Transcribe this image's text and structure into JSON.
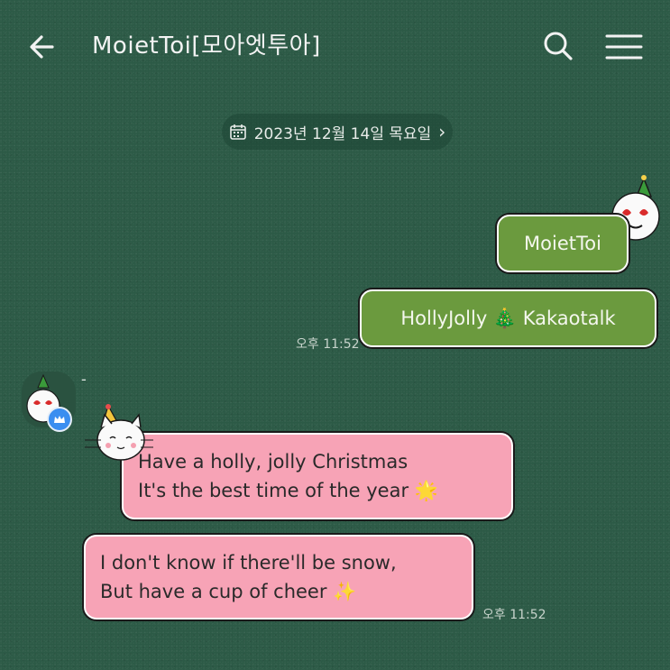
{
  "header": {
    "title": "MoietToi[모아엣투아]",
    "back_icon": "arrow-left-icon",
    "search_icon": "search-icon",
    "menu_icon": "hamburger-menu-icon"
  },
  "date_divider": {
    "label": "2023년 12월 14일 목요일",
    "chevron": "›"
  },
  "messages": {
    "me1": {
      "text": "MoietToi"
    },
    "me2": {
      "text": "HollyJolly 🎄 Kakaotalk"
    },
    "me_time": "오후 11:52",
    "sender_name": "-",
    "other1": {
      "line1": "Have a holly, jolly Christmas",
      "line2": "It's the best time of the year 🌟"
    },
    "other2": {
      "line1": "I don't know if there'll be snow,",
      "line2": "But have a cup of cheer ✨"
    },
    "other_time": "오후 11:52"
  },
  "colors": {
    "background": "#2c5a46",
    "my_bubble": "#6b9a3e",
    "other_bubble": "#f7a3b6",
    "crown_badge": "#3a8ef0"
  }
}
